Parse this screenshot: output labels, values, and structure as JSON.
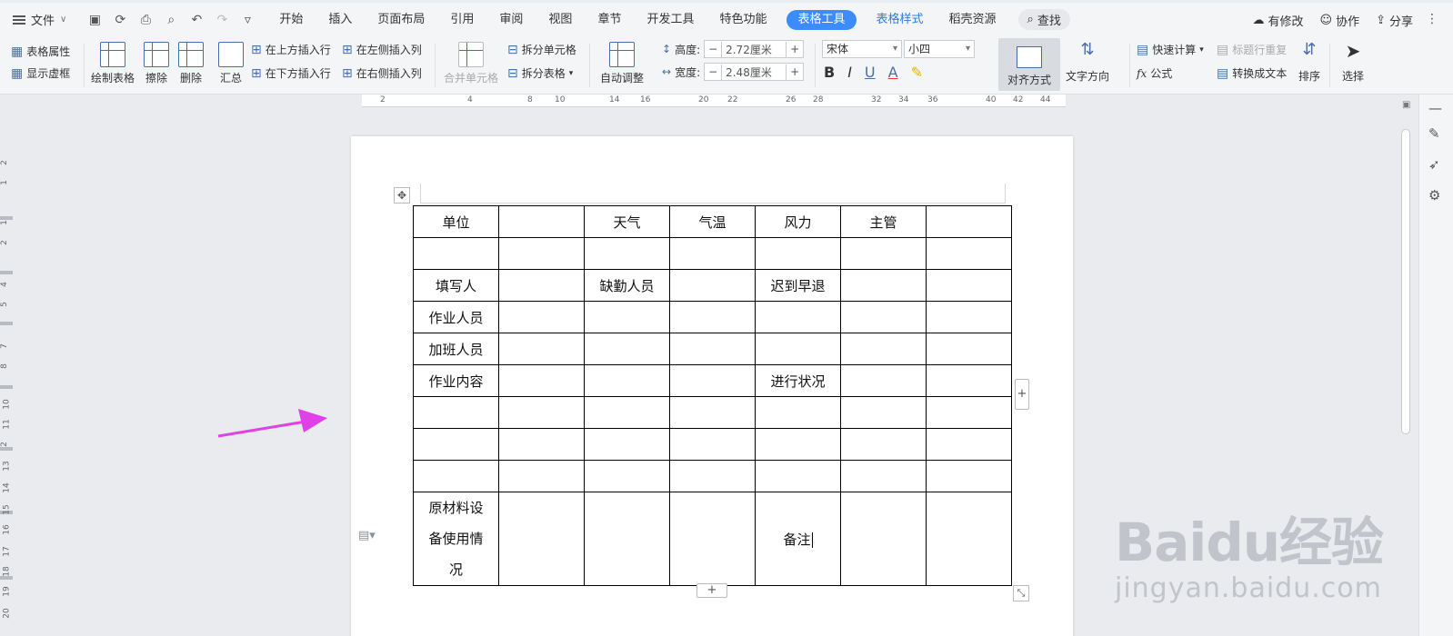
{
  "menubar": {
    "file_label": "文件",
    "tabs": [
      "开始",
      "插入",
      "页面布局",
      "引用",
      "审阅",
      "视图",
      "章节",
      "开发工具",
      "特色功能",
      "表格工具",
      "表格样式",
      "稻壳资源"
    ],
    "search_label": "查找",
    "right": {
      "modified": "有修改",
      "collab": "协作",
      "share": "分享"
    }
  },
  "ribbon": {
    "table_props": "表格属性",
    "show_grid": "显示虚框",
    "draw_table": "绘制表格",
    "erase": "擦除",
    "delete": "删除",
    "summary": "汇总",
    "insert_above": "在上方插入行",
    "insert_below": "在下方插入行",
    "insert_left": "在左侧插入列",
    "insert_right": "在右侧插入列",
    "merge_cells": "合并单元格",
    "split_cells": "拆分单元格",
    "split_table": "拆分表格",
    "auto_fit": "自动调整",
    "height_label": "高度:",
    "height_value": "2.72厘米",
    "width_label": "宽度:",
    "width_value": "2.48厘米",
    "font_name": "宋体",
    "font_size": "小四",
    "align_label": "对齐方式",
    "text_direction": "文字方向",
    "quick_calc": "快速计算",
    "title_repeat": "标题行重复",
    "formula": "公式",
    "to_text": "转换成文本",
    "sort": "排序",
    "select": "选择"
  },
  "ruler": {
    "h_ticks": [
      "2",
      "4",
      "8",
      "10",
      "14",
      "16",
      "20",
      "22",
      "26",
      "28",
      "32",
      "34",
      "36",
      "40",
      "42",
      "44"
    ],
    "v_ticks": [
      "2",
      "1",
      "1",
      "2",
      "4",
      "5",
      "7",
      "8",
      "10",
      "11",
      "2",
      "13",
      "14",
      "15",
      "16",
      "17",
      "18",
      "19",
      "20"
    ]
  },
  "table": {
    "rows": [
      [
        "单位",
        "",
        "天气",
        "气温",
        "风力",
        "主管",
        ""
      ],
      [
        "",
        "",
        "",
        "",
        "",
        "",
        ""
      ],
      [
        "填写人",
        "",
        "缺勤人员",
        "",
        "迟到早退",
        "",
        ""
      ],
      [
        "作业人员",
        "",
        "",
        "",
        "",
        "",
        ""
      ],
      [
        "加班人员",
        "",
        "",
        "",
        "",
        "",
        ""
      ],
      [
        "作业内容",
        "",
        "",
        "",
        "进行状况",
        "",
        ""
      ],
      [
        "",
        "",
        "",
        "",
        "",
        "",
        ""
      ],
      [
        "",
        "",
        "",
        "",
        "",
        "",
        ""
      ],
      [
        "",
        "",
        "",
        "",
        "",
        "",
        ""
      ]
    ],
    "last_row": {
      "first_cell_lines": [
        "原材料设",
        "备使用情",
        "况"
      ],
      "remark": "备注"
    }
  },
  "controls": {
    "add_symbol": "+"
  },
  "watermark": {
    "main": "Baidu经验",
    "sub": "jingyan.baidu.com"
  },
  "colors": {
    "accent": "#3c8cff",
    "arrow": "#e040e8"
  }
}
